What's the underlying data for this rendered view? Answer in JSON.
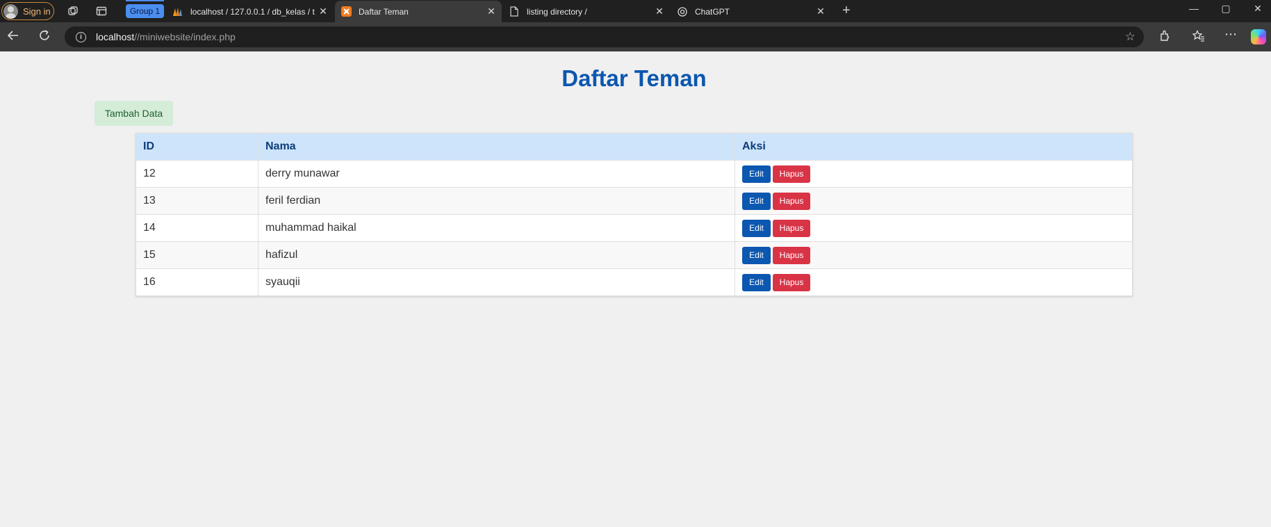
{
  "browser": {
    "signin_label": "Sign in",
    "group_label": "Group 1",
    "tabs": [
      {
        "title": "localhost / 127.0.0.1 / db_kelas / t",
        "favicon": "phpmyadmin-icon"
      },
      {
        "title": "Daftar Teman",
        "favicon": "xampp-icon",
        "active": true
      },
      {
        "title": "listing directory /",
        "favicon": "document-icon"
      },
      {
        "title": "ChatGPT",
        "favicon": "chatgpt-icon"
      }
    ],
    "address": {
      "host": "localhost",
      "path": "//miniwebsite/index.php"
    }
  },
  "page": {
    "title": "Daftar Teman",
    "add_button": "Tambah Data",
    "table": {
      "headers": [
        "ID",
        "Nama",
        "Aksi"
      ],
      "rows": [
        {
          "id": "12",
          "nama": "derry munawar"
        },
        {
          "id": "13",
          "nama": "feril ferdian"
        },
        {
          "id": "14",
          "nama": "muhammad haikal"
        },
        {
          "id": "15",
          "nama": "hafizul"
        },
        {
          "id": "16",
          "nama": "syauqii"
        }
      ],
      "edit_label": "Edit",
      "delete_label": "Hapus"
    }
  },
  "colors": {
    "title": "#0c57b0",
    "header_bg": "#cde4fb",
    "edit": "#0c57b0",
    "delete": "#d93446",
    "add_bg": "#d4ecd8"
  }
}
